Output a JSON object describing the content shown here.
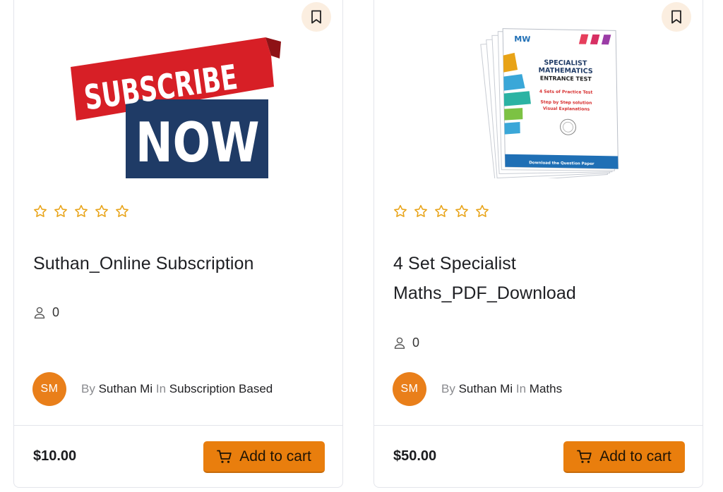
{
  "courses": [
    {
      "thumbnail": {
        "line1": "SUBSCRIBE",
        "line2": "NOW"
      },
      "rating_stars": 5,
      "rating_value": 0,
      "title": "Suthan_Online Subscription",
      "enrolled": "0",
      "author": {
        "initials": "SM",
        "by": "By",
        "name": "Suthan Mi",
        "in": "In",
        "category": "Subscription Based"
      },
      "price": "$10.00",
      "cart_label": "Add to cart"
    },
    {
      "thumbnail": {
        "logo": "MW",
        "title_line1": "SPECIALIST",
        "title_line2": "MATHEMATICS",
        "title_line3": "ENTRANCE TEST",
        "sub1": "4 Sets of Practice Test",
        "sub2": "Step by Step solution",
        "sub3": "Visual Explanations",
        "footer": "Download the Question Paper"
      },
      "rating_stars": 5,
      "rating_value": 0,
      "title": "4 Set Specialist Maths_PDF_Download",
      "enrolled": "0",
      "author": {
        "initials": "SM",
        "by": "By",
        "name": "Suthan Mi",
        "in": "In",
        "category": "Maths"
      },
      "price": "$50.00",
      "cart_label": "Add to cart"
    }
  ],
  "colors": {
    "accent": "#e97e0d",
    "star": "#e8a317",
    "bookmark_bg": "#fbeee0",
    "ribbon_red": "#d71f26",
    "box_navy": "#1f3b66"
  },
  "icons": {
    "bookmark": "bookmark-icon",
    "star": "star-outline-icon",
    "user": "user-icon",
    "cart": "cart-icon"
  }
}
